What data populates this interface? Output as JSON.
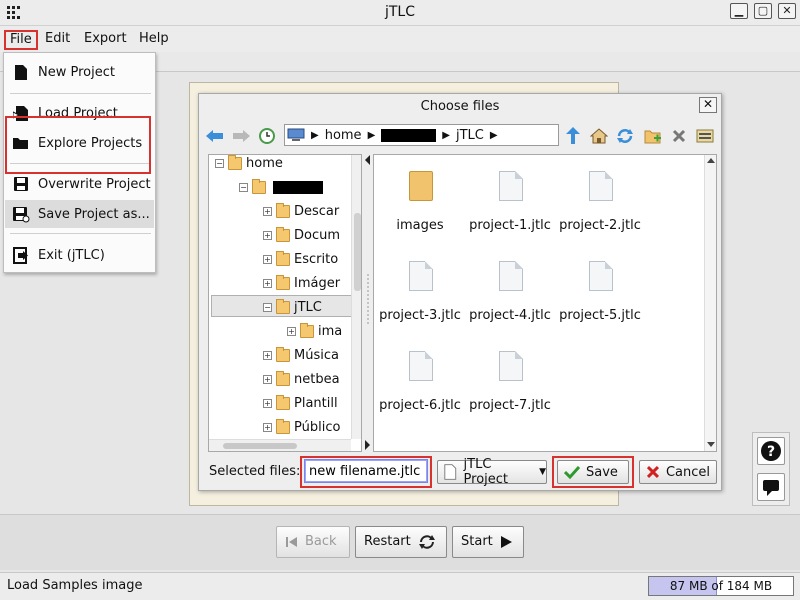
{
  "window": {
    "title": "jTLC"
  },
  "menubar": {
    "items": [
      "File",
      "Edit",
      "Export",
      "Help"
    ]
  },
  "file_menu": {
    "items": [
      {
        "label": "New Project",
        "icon": "new-document-icon"
      },
      {
        "label": "Load Project",
        "icon": "load-document-icon"
      },
      {
        "label": "Explore Projects",
        "icon": "folder-open-icon"
      },
      {
        "label": "Overwrite Project",
        "icon": "save-disk-icon"
      },
      {
        "label": "Save Project as...",
        "icon": "save-as-disk-icon"
      },
      {
        "label": "Exit (jTLC)",
        "icon": "exit-icon"
      }
    ]
  },
  "dialog": {
    "title": "Choose files",
    "path": {
      "home": "home",
      "current": "jTLC"
    },
    "tree": [
      {
        "label": "home",
        "toggle": "-"
      },
      {
        "label": "",
        "toggle": "-"
      },
      {
        "label": "Descar",
        "toggle": "+"
      },
      {
        "label": "Docum",
        "toggle": "+"
      },
      {
        "label": "Escrito",
        "toggle": "+"
      },
      {
        "label": "Imáger",
        "toggle": "+"
      },
      {
        "label": "jTLC",
        "toggle": "-"
      },
      {
        "label": "ima",
        "toggle": "+"
      },
      {
        "label": "Música",
        "toggle": "+"
      },
      {
        "label": "netbea",
        "toggle": "+"
      },
      {
        "label": "Plantill",
        "toggle": "+"
      },
      {
        "label": "Público",
        "toggle": "+"
      }
    ],
    "files": [
      "images",
      "project-1.jtlc",
      "project-2.jtlc",
      "project-3.jtlc",
      "project-4.jtlc",
      "project-5.jtlc",
      "project-6.jtlc",
      "project-7.jtlc"
    ],
    "selected_label": "Selected files:",
    "filename_value": "new filename.jtlc",
    "filetype": "jTLC Project",
    "save_label": "Save",
    "cancel_label": "Cancel"
  },
  "nav": {
    "back": "Back",
    "restart": "Restart",
    "start": "Start"
  },
  "help": {
    "question": "?"
  },
  "status": {
    "text": "Load Samples image",
    "memory_text": "87 MB of 184 MB",
    "memory_fraction": 0.473
  },
  "colors": {
    "highlight": "#d8322e",
    "accent": "#3a8fd8",
    "folder": "#f5c870",
    "save_check": "#2e9a2e",
    "cancel_x": "#d02020"
  }
}
